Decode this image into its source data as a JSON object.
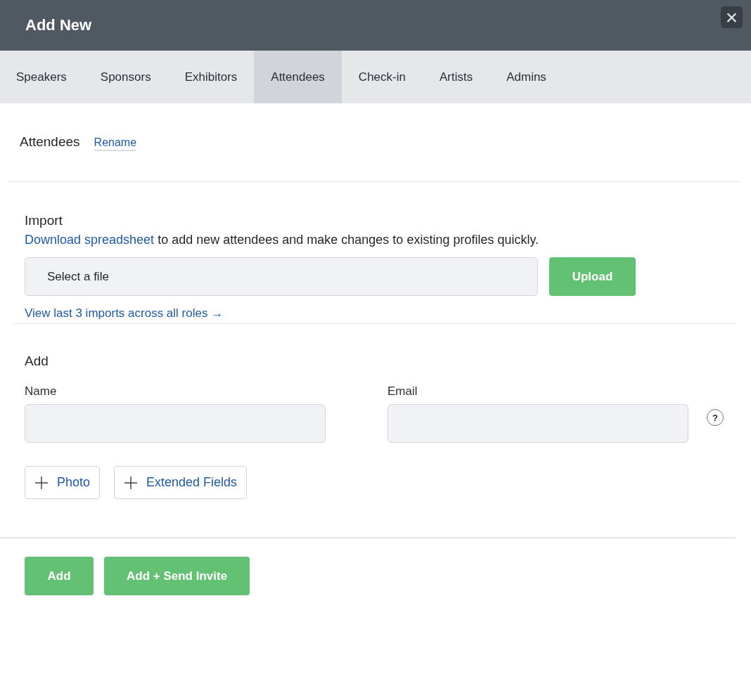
{
  "window": {
    "title": "Add New",
    "close": "×"
  },
  "tabs": [
    {
      "label": "Speakers",
      "selected": false
    },
    {
      "label": "Sponsors",
      "selected": false
    },
    {
      "label": "Exhibitors",
      "selected": false
    },
    {
      "label": "Attendees",
      "selected": true
    },
    {
      "label": "Check-in",
      "selected": false
    },
    {
      "label": "Artists",
      "selected": false
    },
    {
      "label": "Admins",
      "selected": false
    }
  ],
  "section": {
    "title": "Attendees",
    "rename": "Rename"
  },
  "import": {
    "heading": "Import",
    "link": "Download spreadsheet",
    "text": " to add new attendees and make changes to existing profiles quickly.",
    "file_placeholder": "Select a file",
    "upload": "Upload",
    "history_link": "View last 3 imports across all roles →"
  },
  "add": {
    "heading": "Add",
    "fields": [
      {
        "label": "Name"
      },
      {
        "label": "Email"
      }
    ],
    "help": "?",
    "extras": [
      "Photo",
      "Extended Fields"
    ]
  },
  "footer": {
    "buttons": [
      "Add",
      "Add + Send Invite"
    ]
  }
}
